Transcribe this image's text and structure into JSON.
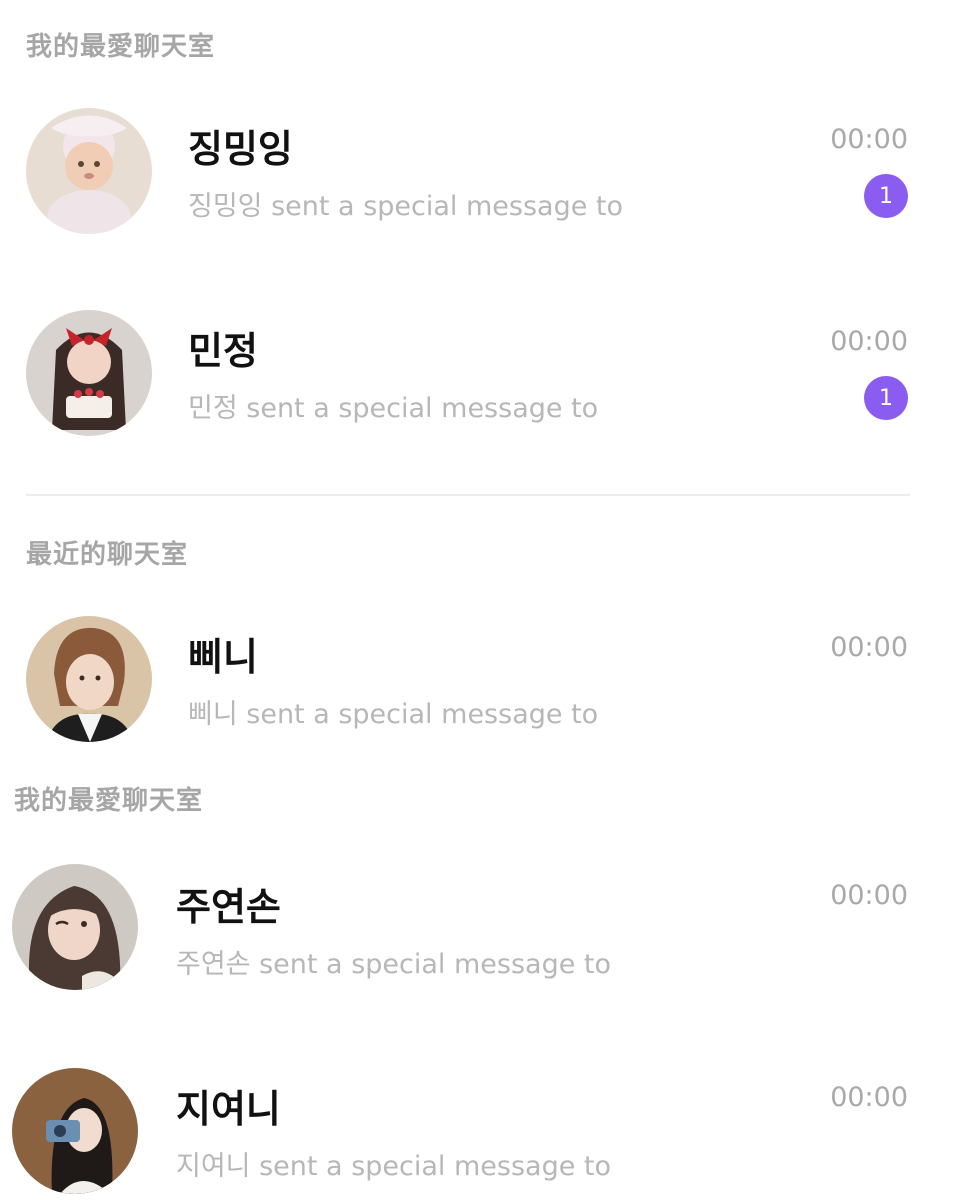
{
  "colors": {
    "badge": "#8b5cf0",
    "name": "#111111",
    "preview": "#b7b7b7",
    "header": "#a6a6a6",
    "time": "#a9a9a9"
  },
  "sections": [
    {
      "title": "我的最愛聊天室",
      "chats": [
        {
          "name": "징밍잉",
          "preview": "징밍잉 sent a special message to",
          "time": "00:00",
          "unread": "1",
          "avatar": "avatar-baby"
        },
        {
          "name": "민정",
          "preview": "민정 sent a special message to",
          "time": "00:00",
          "unread": "1",
          "avatar": "avatar-red-ribbon"
        }
      ]
    },
    {
      "title": "最近的聊天室",
      "chats": [
        {
          "name": "삐니",
          "preview": "삐니 sent a special message to",
          "time": "00:00",
          "avatar": "avatar-brown-hair"
        }
      ]
    },
    {
      "title": "我的最愛聊天室",
      "chats": [
        {
          "name": "주연손",
          "preview": "주연손 sent a special message to",
          "time": "00:00",
          "avatar": "avatar-wink"
        },
        {
          "name": "지여니",
          "preview": "지여니 sent a special message to",
          "time": "00:00",
          "avatar": "avatar-camera"
        }
      ]
    }
  ]
}
